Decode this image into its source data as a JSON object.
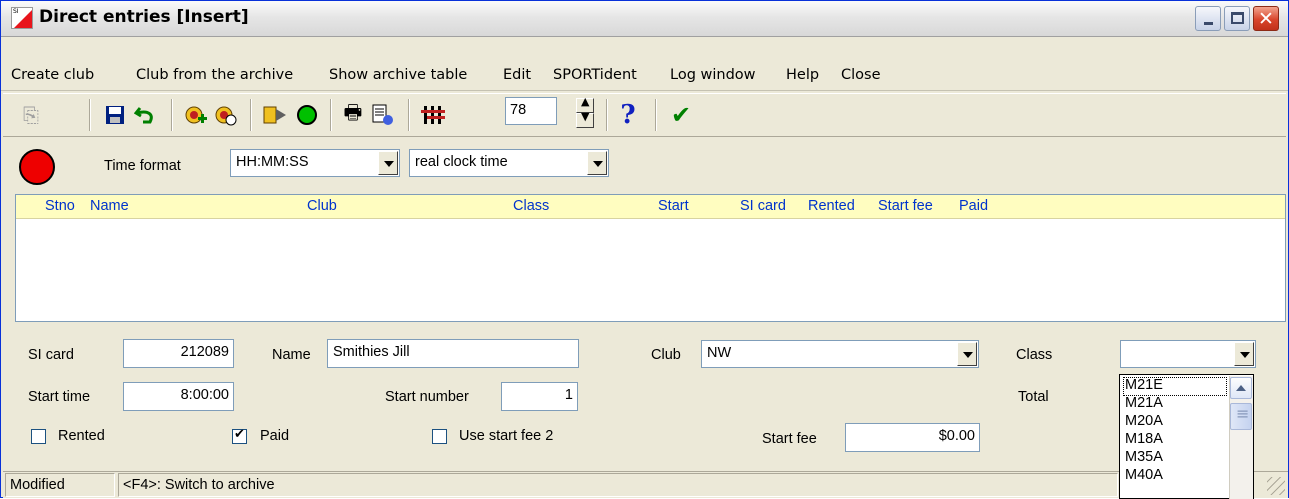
{
  "window": {
    "title": "Direct entries [Insert]",
    "icon_text": "SI"
  },
  "menu": {
    "items": [
      "Create club",
      "Club from the archive",
      "Show archive table",
      "Edit",
      "SPORTident",
      "Log window",
      "Help",
      "Close"
    ]
  },
  "toolbar": {
    "spinner_value": "78",
    "icons": [
      "disabled-icon",
      "save-icon",
      "undo-icon",
      "add-club-icon",
      "club-search-icon",
      "readout-icon",
      "green-circle-icon",
      "print-icon",
      "print-preview-icon",
      "settings-icon",
      "help-icon",
      "check-icon"
    ]
  },
  "time_row": {
    "label": "Time format",
    "format_value": "HH:MM:SS",
    "mode_value": "real clock time",
    "status_color": "#ee0000"
  },
  "list": {
    "columns": [
      "Stno",
      "Name",
      "Club",
      "Class",
      "Start",
      "SI card",
      "Rented",
      "Start fee",
      "Paid"
    ],
    "rows": []
  },
  "form": {
    "si_card_label": "SI card",
    "si_card_value": "212089",
    "name_label": "Name",
    "name_value": "Smithies Jill",
    "club_label": "Club",
    "club_value": "NW",
    "class_label": "Class",
    "class_value": "",
    "start_time_label": "Start time",
    "start_time_value": "8:00:00",
    "start_number_label": "Start number",
    "start_number_value": "1",
    "total_label": "Total",
    "rented_label": "Rented",
    "rented_checked": false,
    "paid_label": "Paid",
    "paid_checked": true,
    "use_start_fee2_label": "Use start fee 2",
    "use_start_fee2_checked": false,
    "start_fee_label": "Start fee",
    "start_fee_value": "$0.00"
  },
  "class_dropdown": {
    "options": [
      "M21E",
      "M21A",
      "M20A",
      "M18A",
      "M35A",
      "M40A"
    ],
    "highlighted": "M21E"
  },
  "status": {
    "mode": "Modified",
    "hint": "<F4>: Switch to archive"
  }
}
